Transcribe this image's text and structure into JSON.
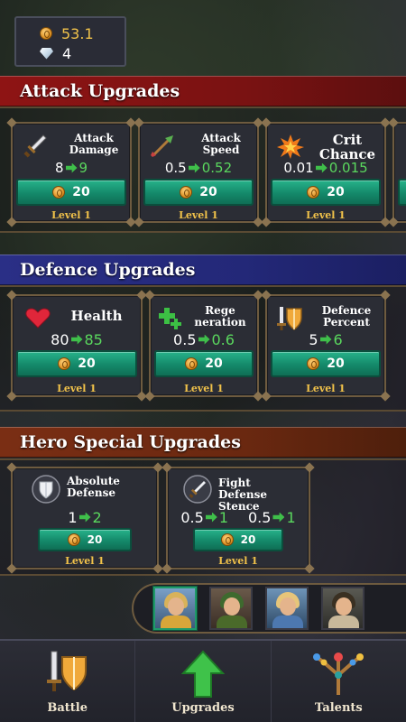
{
  "currency": {
    "gold": "53.1",
    "gems": "4"
  },
  "sections": {
    "attack": "Attack Upgrades",
    "defence": "Defence Upgrades",
    "hero": "Hero Special Upgrades"
  },
  "attack_cards": [
    {
      "title_l1": "Attack",
      "title_l2": "Damage",
      "from": "8",
      "to": "9",
      "cost": "20",
      "level": "Level 1"
    },
    {
      "title_l1": "Attack",
      "title_l2": "Speed",
      "from": "0.5",
      "to": "0.52",
      "cost": "20",
      "level": "Level 1"
    },
    {
      "title_l1": "Crit",
      "title_l2": "Chance",
      "from": "0.01",
      "to": "0.015",
      "cost": "20",
      "level": "Level 1"
    }
  ],
  "defence_cards": [
    {
      "title_l1": "Health",
      "from": "80",
      "to": "85",
      "cost": "20",
      "level": "Level 1"
    },
    {
      "title_l1": "Rege",
      "title_l2": "neration",
      "from": "0.5",
      "to": "0.6",
      "cost": "20",
      "level": "Level 1"
    },
    {
      "title_l1": "Defence",
      "title_l2": "Percent",
      "from": "5",
      "to": "6",
      "cost": "20",
      "level": "Level 1"
    }
  ],
  "hero_cards": [
    {
      "title_l1": "Absolute",
      "title_l2": "Defense",
      "from": "1",
      "to": "2",
      "cost": "20",
      "level": "Level 1"
    },
    {
      "title_l1": "Fight",
      "title_l2": "Defense Stence",
      "from": "0.5",
      "to": "1",
      "from2": "0.5",
      "to2": "1",
      "cost": "20",
      "level": "Level 1"
    }
  ],
  "nav": {
    "battle": "Battle",
    "upgrades": "Upgrades",
    "talents": "Talents"
  },
  "colors": {
    "accent_green": "#3fbf4a",
    "gold": "#f1c24a",
    "button": "#14896a"
  }
}
